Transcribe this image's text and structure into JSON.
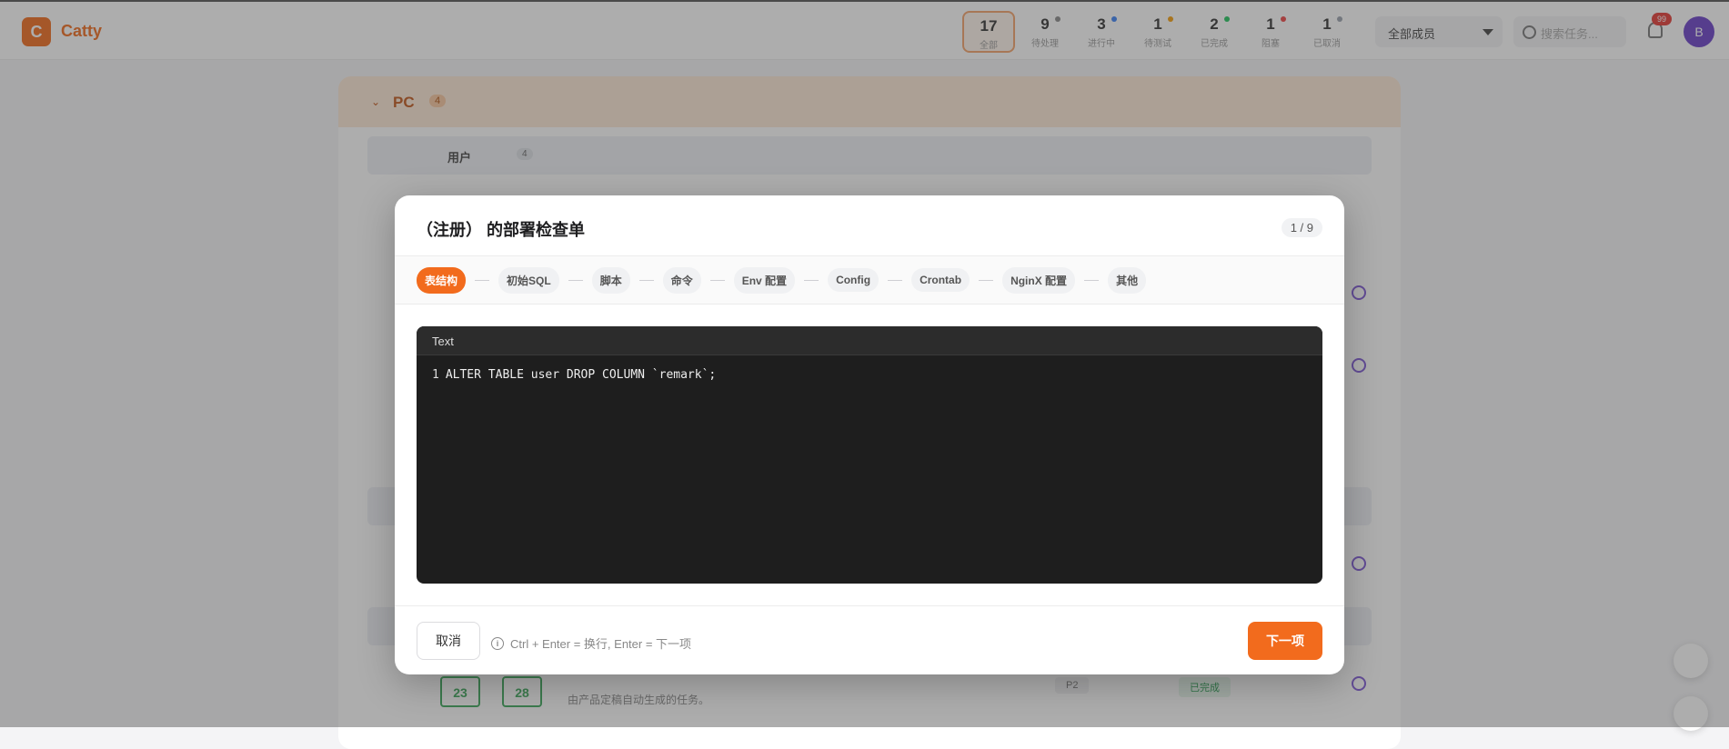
{
  "app": {
    "logo_letter": "C",
    "name": "Catty"
  },
  "stats": [
    {
      "num": "17",
      "label": "全部",
      "dot": ""
    },
    {
      "num": "9",
      "label": "待处理",
      "dot": "#8a8a8a"
    },
    {
      "num": "3",
      "label": "进行中",
      "dot": "#3b82f6"
    },
    {
      "num": "1",
      "label": "待测试",
      "dot": "#f59e0b"
    },
    {
      "num": "2",
      "label": "已完成",
      "dot": "#22c55e"
    },
    {
      "num": "1",
      "label": "阻塞",
      "dot": "#ef4444"
    },
    {
      "num": "1",
      "label": "已取消",
      "dot": "#9ca3af"
    }
  ],
  "topbar": {
    "member_select": "全部成员",
    "search_placeholder": "搜索任务...",
    "notif_badge": "99",
    "avatar_letter": "B"
  },
  "board": {
    "group_name": "PC",
    "group_count": "4",
    "subgroup_name": "用户",
    "subgroup_count": "4",
    "row_dates": [
      "23",
      "28"
    ],
    "row_desc": "由产品定稿自动生成的任务。",
    "row_priority": "P2",
    "row_status": "已完成"
  },
  "modal": {
    "title": "（注册） 的部署检查单",
    "counter": "1 / 9",
    "steps": [
      "表结构",
      "初始SQL",
      "脚本",
      "命令",
      "Env 配置",
      "Config",
      "Crontab",
      "NginX 配置",
      "其他"
    ],
    "active_step": 0,
    "editor": {
      "mode": "Text",
      "lines": [
        "ALTER TABLE user DROP COLUMN `remark`;"
      ]
    },
    "cancel_label": "取消",
    "hint": "Ctrl + Enter = 换行, Enter = 下一项",
    "next_label": "下一项"
  }
}
